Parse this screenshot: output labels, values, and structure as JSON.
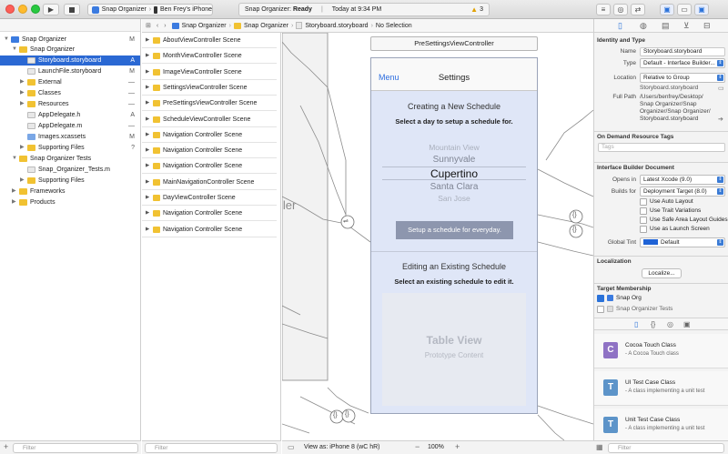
{
  "toolbar": {
    "scheme": "Snap Organizer",
    "device": "Ben Frey's iPhone",
    "status_app": "Snap Organizer:",
    "status_state": "Ready",
    "status_time": "Today at 9:34 PM",
    "warning_count": "3"
  },
  "jumpbar": {
    "crumbs": [
      "Snap Organizer",
      "Snap Organizer",
      "Storyboard.storyboard",
      "No Selection"
    ]
  },
  "navigator": {
    "items": [
      {
        "label": "Snap Organizer",
        "status": "M"
      },
      {
        "label": "Snap Organizer",
        "status": ""
      },
      {
        "label": "Storyboard.storyboard",
        "status": "A"
      },
      {
        "label": "LaunchFile.storyboard",
        "status": "M"
      },
      {
        "label": "External",
        "status": "—"
      },
      {
        "label": "Classes",
        "status": "—"
      },
      {
        "label": "Resources",
        "status": "—"
      },
      {
        "label": "AppDelegate.h",
        "status": "A"
      },
      {
        "label": "AppDelegate.m",
        "status": "—"
      },
      {
        "label": "Images.xcassets",
        "status": "M"
      },
      {
        "label": "Supporting Files",
        "status": "?"
      },
      {
        "label": "Snap Organizer Tests",
        "status": ""
      },
      {
        "label": "Snap_Organizer_Tests.m",
        "status": ""
      },
      {
        "label": "Supporting Files",
        "status": ""
      },
      {
        "label": "Frameworks",
        "status": ""
      },
      {
        "label": "Products",
        "status": ""
      }
    ],
    "filter_placeholder": "Filter"
  },
  "scenes": {
    "items": [
      "AboutViewController Scene",
      "MonthViewController Scene",
      "ImageViewController Scene",
      "SettingsViewController Scene",
      "PreSettingsViewController Scene",
      "ScheduleViewController Scene",
      "Navigation Controller Scene",
      "Navigation Controller Scene",
      "Navigation Controller Scene",
      "MainNavigationController Scene",
      "DayViewController Scene",
      "Navigation Controller Scene",
      "Navigation Controller Scene"
    ],
    "filter_placeholder": "Filter"
  },
  "canvas": {
    "scene_title": "PreSettingsViewController",
    "nav_back": "Menu",
    "nav_title": "Settings",
    "section1_title": "Creating a New Schedule",
    "section1_subtitle": "Select a day to setup a schedule for.",
    "picker": [
      "Mountain View",
      "Sunnyvale",
      "Cupertino",
      "Santa Clara",
      "San Jose"
    ],
    "setup_button": "Setup a schedule for everyday.",
    "section2_title": "Editing an Existing Schedule",
    "section2_subtitle": "Select an existing schedule to edit it.",
    "table_title": "Table View",
    "table_subtitle": "Prototype Content",
    "partial_label": "ller",
    "view_as": "View as: iPhone 8 (wC hR)",
    "zoom": "100%"
  },
  "inspector": {
    "identity_header": "Identity and Type",
    "name_label": "Name",
    "name_value": "Storyboard.storyboard",
    "type_label": "Type",
    "type_value": "Default - Interface Builder...",
    "location_label": "Location",
    "location_value": "Relative to Group",
    "location_file": "Storyboard.storyboard",
    "fullpath_label": "Full Path",
    "fullpath_lines": [
      "/Users/benfrey/Desktop/",
      "Snap Organizer/Snap",
      "Organizer/Snap Organizer/",
      "Storyboard.storyboard"
    ],
    "odr_header": "On Demand Resource Tags",
    "tags_placeholder": "Tags",
    "ibdoc_header": "Interface Builder Document",
    "opens_in_label": "Opens in",
    "opens_in_value": "Latest Xcode (9.0)",
    "builds_for_label": "Builds for",
    "builds_for_value": "Deployment Target (8.0)",
    "options": [
      "Use Auto Layout",
      "Use Trait Variations",
      "Use Safe Area Layout Guides",
      "Use as Launch Screen"
    ],
    "global_tint_label": "Global Tint",
    "global_tint_value": "Default",
    "tint_color": "#1f63d6",
    "localization_header": "Localization",
    "localize_button": "Localize...",
    "target_header": "Target Membership",
    "targets": [
      "Snap Org",
      "Snap Organizer Tests"
    ],
    "library": [
      {
        "letter": "C",
        "title": "Cocoa Touch Class",
        "desc": "- A Cocoa Touch class",
        "color": "#8f72c4"
      },
      {
        "letter": "T",
        "title": "UI Test Case Class",
        "desc": "- A class implementing a unit test",
        "color": "#5d94c9"
      },
      {
        "letter": "T",
        "title": "Unit Test Case Class",
        "desc": "- A class implementing a unit test",
        "color": "#5d94c9"
      }
    ],
    "filter_placeholder": "Filter"
  },
  "colors": {
    "selection": "#2a68d3",
    "folder": "#f1c232",
    "accent": "#2a72d9"
  }
}
